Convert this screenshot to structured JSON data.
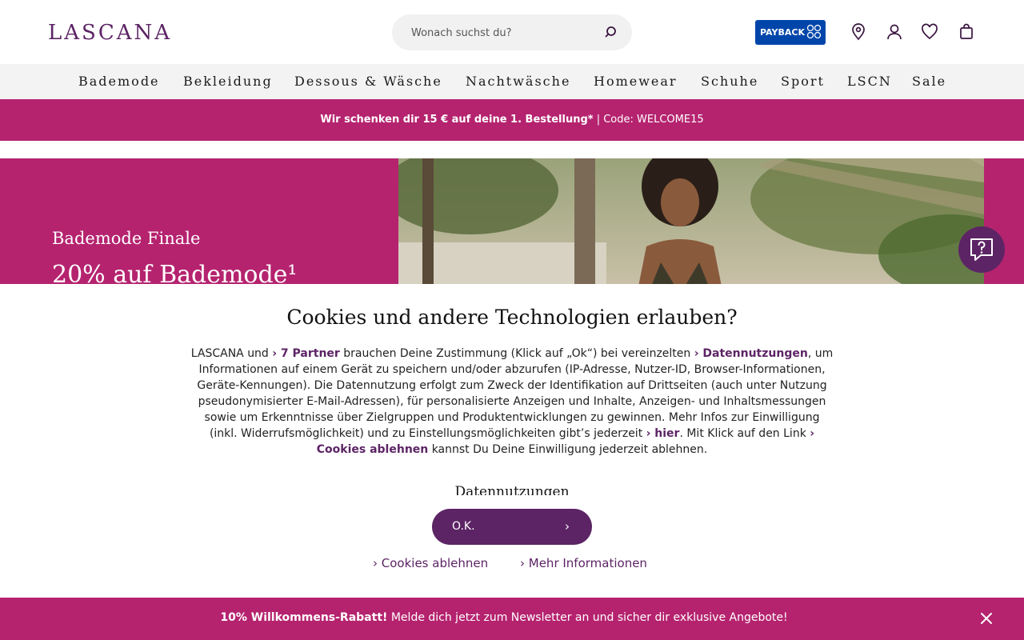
{
  "header": {
    "logo": "LASCANA",
    "search_placeholder": "Wonach suchst du?",
    "payback_label": "PAYBACK"
  },
  "nav": {
    "items": [
      "Bademode",
      "Bekleidung",
      "Dessous & Wäsche",
      "Nachtwäsche",
      "Homewear",
      "Schuhe",
      "Sport",
      "LSCN",
      "Sale"
    ]
  },
  "promo": {
    "bold": "Wir schenken dir 15 € auf deine 1. Bestellung*",
    "rest": " | Code: WELCOME15"
  },
  "hero": {
    "subtitle": "Bademode Finale",
    "title": "20% auf Bademode¹"
  },
  "cookie": {
    "title": "Cookies und andere Technologien erlauben?",
    "t1": "LASCANA und ",
    "link_partner": "› 7 Partner",
    "t2": " brauchen Deine Zustimmung (Klick auf „Ok“) bei vereinzelten ",
    "link_datennutzungen": "› Datennutzungen",
    "t3": ", um Informationen auf einem Gerät zu speichern und/oder abzurufen (IP-Adresse, Nutzer-ID, Browser-Informationen, Geräte-Kennungen). Die Datennutzung erfolgt zum Zweck der Identifikation auf Drittseiten (auch unter Nutzung pseudonymisierter E-Mail-Adressen), für personalisierte Anzeigen und Inhalte, Anzeigen- und Inhaltsmessungen sowie um Erkenntnisse über Zielgruppen und Produktentwicklungen zu gewinnen. Mehr Infos zur Einwilligung (inkl. Widerrufsmöglichkeit) und zu Einstellungsmöglichkeiten gibt’s jederzeit ",
    "link_hier": "› hier",
    "t4": ". Mit Klick auf den Link ",
    "link_ablehnen": "› Cookies ablehnen",
    "t5": " kannst Du Deine Einwilligung jederzeit ablehnen.",
    "section_heading": "Datennutzungen",
    "ok_label": "O.K.",
    "ok_chevron": "›",
    "reject_link": "› Cookies ablehnen",
    "more_link": "› Mehr Informationen"
  },
  "newsletter": {
    "bold": "10% Willkommens-Rabatt!",
    "rest": " Melde dich jetzt zum Newsletter an und sicher dir exklusive Angebote!"
  },
  "colors": {
    "brand_purple": "#5c2465",
    "magenta": "#b5236f",
    "payback_blue": "#0046aa"
  },
  "icons": {
    "search": "search-icon",
    "store": "location-pin-icon",
    "account": "user-icon",
    "wishlist": "heart-icon",
    "cart": "shopping-bag-icon",
    "chat": "chat-help-icon",
    "close": "close-icon"
  }
}
